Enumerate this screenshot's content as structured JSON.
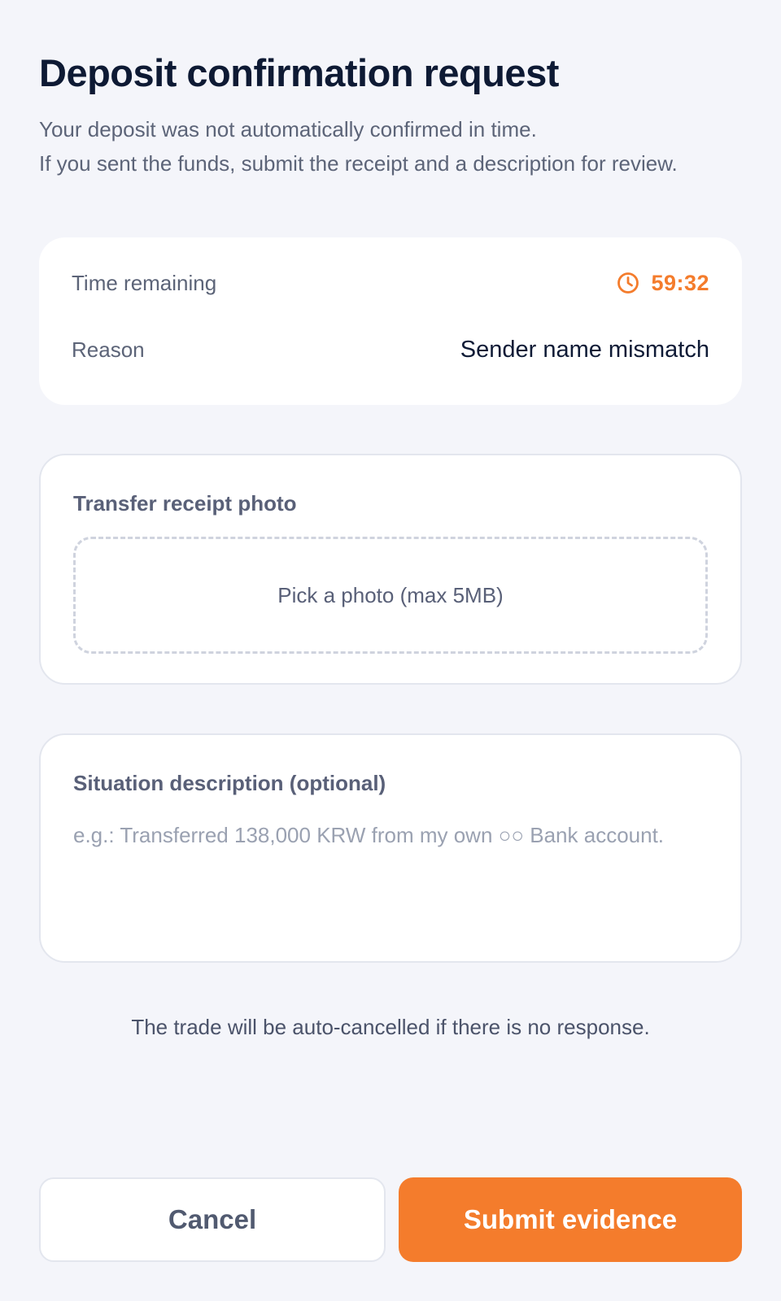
{
  "header": {
    "title": "Deposit confirmation request",
    "subtitle_line1": "Your deposit was not automatically confirmed in time.",
    "subtitle_line2": "If you sent the funds, submit the receipt and a description for review."
  },
  "info": {
    "time_label": "Time remaining",
    "time_value": "59:32",
    "reason_label": "Reason",
    "reason_value": "Sender name mismatch"
  },
  "receipt": {
    "label": "Transfer receipt photo",
    "picker_text": "Pick a photo (max 5MB)"
  },
  "description": {
    "label": "Situation description (optional)",
    "value": "",
    "placeholder": "e.g.: Transferred 138,000 KRW from my own ○○ Bank account."
  },
  "notice": "The trade will be auto-cancelled if there is no response.",
  "actions": {
    "cancel_label": "Cancel",
    "submit_label": "Submit evidence"
  },
  "colors": {
    "accent": "#f47c2c",
    "background": "#f4f5fa",
    "card": "#ffffff"
  },
  "icons": {
    "timer": "clock-icon"
  }
}
